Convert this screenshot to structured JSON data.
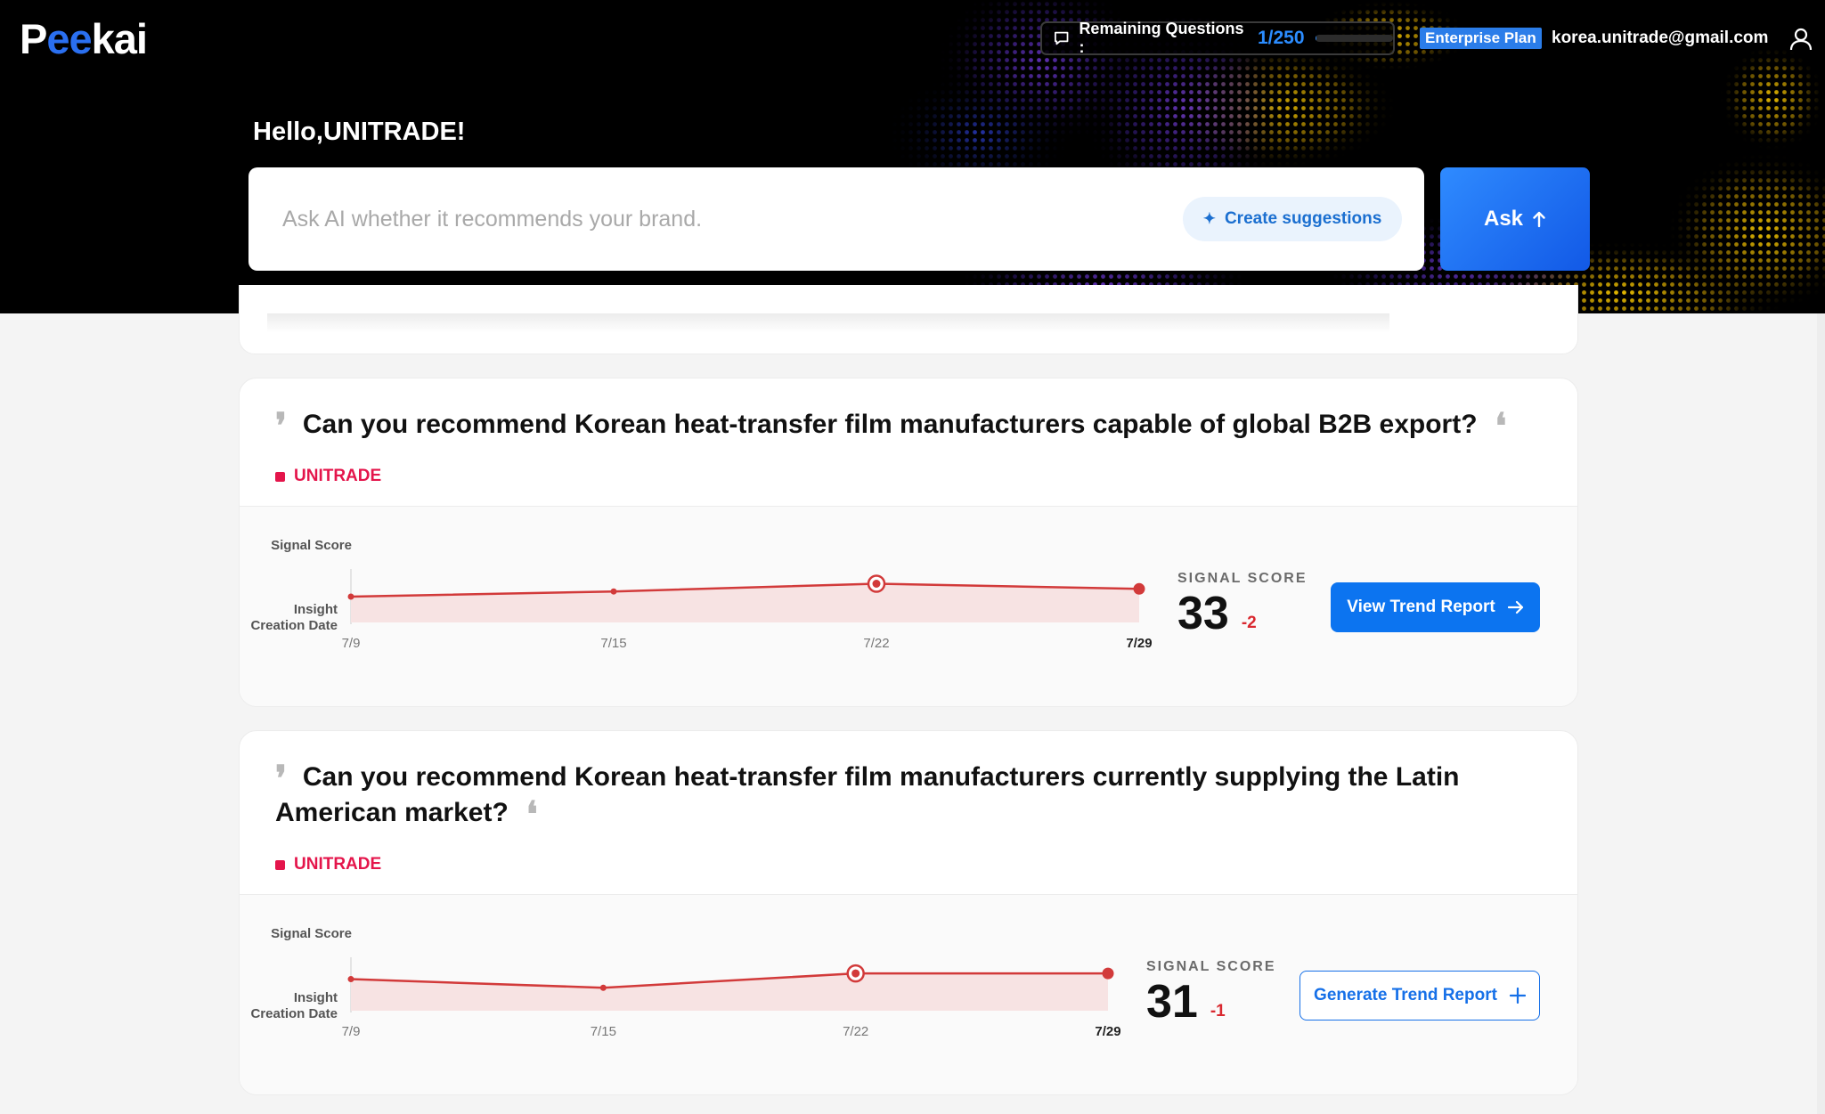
{
  "app": {
    "logo_text_1": "P",
    "logo_text_2": "ee",
    "logo_text_3": "kai"
  },
  "header": {
    "remaining_label": "Remaining Questions :",
    "remaining_count": "1/250",
    "remaining_fraction": 0.004,
    "plan": "Enterprise Plan",
    "email": "korea.unitrade@gmail.com",
    "greeting": "Hello,UNITRADE!"
  },
  "ask": {
    "placeholder": "Ask AI whether it recommends your brand.",
    "suggest_label": "Create suggestions",
    "ask_label": "Ask"
  },
  "colors": {
    "accent": "#0c74f0",
    "brand_tag": "#e4154b",
    "series_line": "#d23a3a",
    "delta": "#d9282f"
  },
  "cards": [
    {
      "question": "Can you recommend Korean heat-transfer film manufacturers capable of global B2B export?",
      "brand": "UNITRADE",
      "score_label": "SIGNAL SCORE",
      "score": "33",
      "delta": "-2",
      "button_label": "View Trend Report",
      "button_icon": "arrow-right-icon"
    },
    {
      "question": "Can you recommend Korean heat-transfer film manufacturers currently supplying the Latin American market?",
      "brand": "UNITRADE",
      "score_label": "SIGNAL SCORE",
      "score": "31",
      "delta": "-1",
      "button_label": "Generate Trend Report",
      "button_icon": "plus-icon"
    }
  ],
  "chart_data": [
    {
      "type": "area",
      "ylabel": "Signal Score",
      "xlabel": "Insight Creation Date",
      "x": [
        "7/9",
        "7/15",
        "7/22",
        "7/29"
      ],
      "series": [
        {
          "values": [
            30,
            32,
            35,
            33
          ]
        }
      ],
      "highlight_index": 2,
      "ylim": [
        20,
        40
      ]
    },
    {
      "type": "area",
      "ylabel": "Signal Score",
      "xlabel": "Insight Creation Date",
      "x": [
        "7/9",
        "7/15",
        "7/22",
        "7/29"
      ],
      "series": [
        {
          "values": [
            29,
            26,
            31,
            31
          ]
        }
      ],
      "highlight_index": 2,
      "ylim": [
        18,
        36
      ]
    }
  ]
}
